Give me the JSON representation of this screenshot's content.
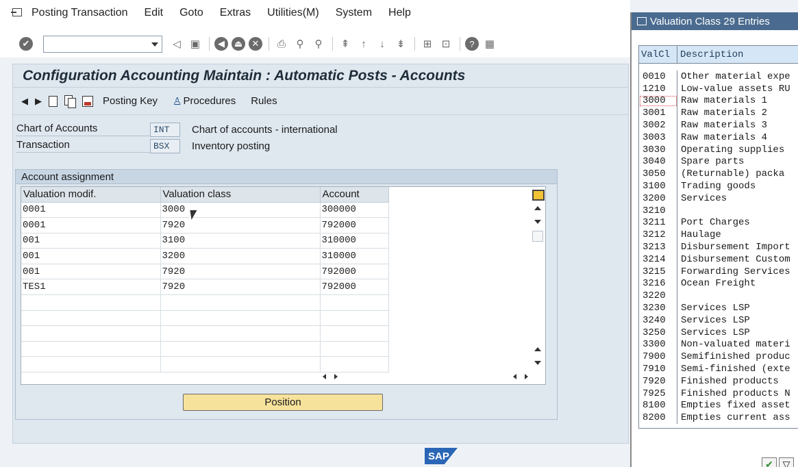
{
  "menu": {
    "items": [
      "Posting Transaction",
      "Edit",
      "Goto",
      "Extras",
      "Utilities(M)",
      "System",
      "Help"
    ]
  },
  "screen": {
    "title": "Configuration Accounting Maintain : Automatic Posts - Accounts",
    "toolbar": {
      "posting_key": "Posting Key",
      "procedures": "Procedures",
      "rules": "Rules"
    },
    "chart_of_accounts": {
      "label": "Chart of Accounts",
      "value": "INT",
      "description": "Chart of accounts - international"
    },
    "transaction": {
      "label": "Transaction",
      "value": "BSX",
      "description": "Inventory posting"
    },
    "group_title": "Account assignment",
    "columns": [
      "Valuation modif.",
      "Valuation class",
      "Account"
    ],
    "rows": [
      [
        "0001",
        "3000",
        "300000"
      ],
      [
        "0001",
        "7920",
        "792000"
      ],
      [
        "001",
        "3100",
        "310000"
      ],
      [
        "001",
        "3200",
        "310000"
      ],
      [
        "001",
        "7920",
        "792000"
      ],
      [
        "TES1",
        "7920",
        "792000"
      ]
    ],
    "position_button": "Position",
    "footer_logo": "SAP"
  },
  "popup": {
    "title": "Valuation Class 29 Entries",
    "col_code": "ValCl",
    "col_desc": "Description",
    "entries": [
      [
        "0010",
        "Other material expe"
      ],
      [
        "1210",
        "Low-value assets RU"
      ],
      [
        "3000",
        "Raw materials 1"
      ],
      [
        "3001",
        "Raw materials 2"
      ],
      [
        "3002",
        "Raw materials 3"
      ],
      [
        "3003",
        "Raw materials 4"
      ],
      [
        "3030",
        "Operating supplies"
      ],
      [
        "3040",
        "Spare parts"
      ],
      [
        "3050",
        "(Returnable) packa"
      ],
      [
        "3100",
        "Trading goods"
      ],
      [
        "3200",
        "Services"
      ],
      [
        "3210",
        ""
      ],
      [
        "3211",
        "Port Charges"
      ],
      [
        "3212",
        "Haulage"
      ],
      [
        "3213",
        "Disbursement Import"
      ],
      [
        "3214",
        "Disbursement Custom"
      ],
      [
        "3215",
        "Forwarding Services"
      ],
      [
        "3216",
        "Ocean Freight"
      ],
      [
        "3220",
        ""
      ],
      [
        "3230",
        "Services LSP"
      ],
      [
        "3240",
        "Services LSP"
      ],
      [
        "3250",
        "Services LSP"
      ],
      [
        "3300",
        "Non-valuated materi"
      ],
      [
        "7900",
        "Semifinished produc"
      ],
      [
        "7910",
        "Semi-finished (exte"
      ],
      [
        "7920",
        "Finished products"
      ],
      [
        "7925",
        "Finished products N"
      ],
      [
        "8100",
        "Empties fixed asset"
      ],
      [
        "8200",
        "Empties current ass"
      ]
    ]
  }
}
